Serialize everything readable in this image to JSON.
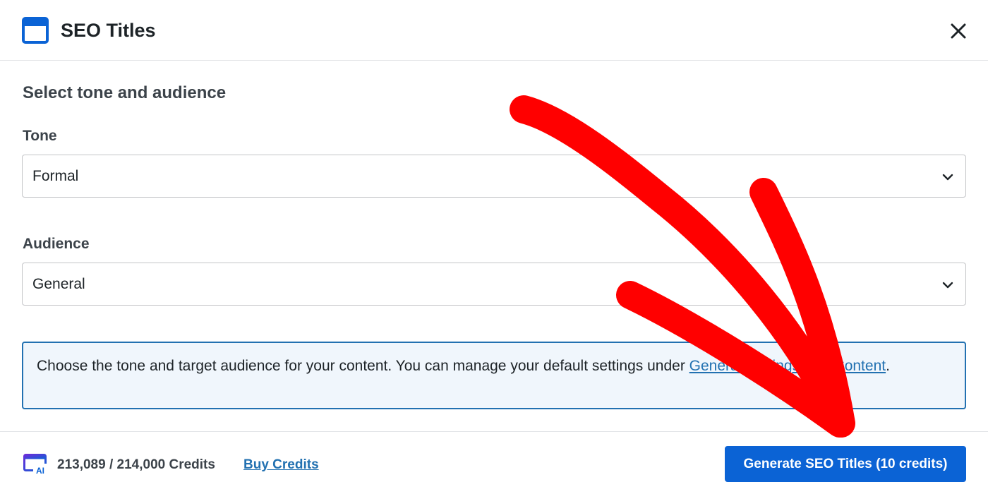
{
  "header": {
    "title": "SEO Titles",
    "icon": "window-icon"
  },
  "form": {
    "section_title": "Select tone and audience",
    "tone": {
      "label": "Tone",
      "selected": "Formal"
    },
    "audience": {
      "label": "Audience",
      "selected": "General"
    }
  },
  "notice": {
    "text_before": "Choose the tone and target audience for your content. You can manage your default settings under ",
    "link_text": "General Settings > AI Content",
    "text_after": "."
  },
  "footer": {
    "credits": "213,089 / 214,000 Credits",
    "buy_credits_label": "Buy Credits",
    "generate_label": "Generate SEO Titles (10 credits)",
    "credits_icon_text": "AI"
  },
  "colors": {
    "accent": "#0b63d5",
    "link": "#2271b1",
    "notice_bg": "#f0f6fc",
    "annotation_arrow": "#ff0000"
  }
}
